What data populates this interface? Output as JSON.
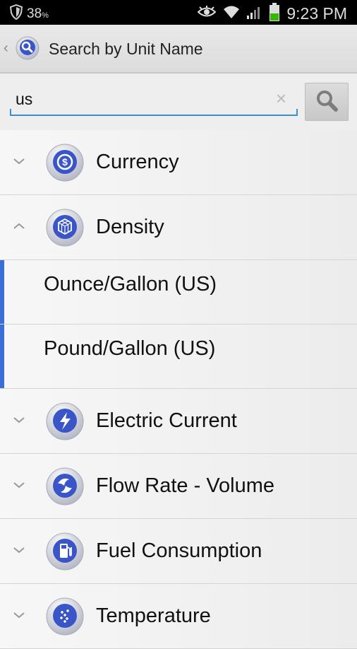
{
  "status_bar": {
    "battery_percent": "38",
    "battery_unit": "%",
    "time": "9:23 PM",
    "icons": [
      "shield-icon",
      "eye-icon",
      "wifi-icon",
      "signal-icon",
      "battery-icon"
    ]
  },
  "action_bar": {
    "title": "Search by Unit Name",
    "icon": "search-app-icon"
  },
  "search": {
    "value": "us",
    "clear_glyph": "×"
  },
  "list": {
    "currency": {
      "label": "Currency",
      "icon": "currency-icon",
      "expanded": false
    },
    "density": {
      "label": "Density",
      "icon": "density-icon",
      "expanded": true
    },
    "units": [
      "Ounce/Gallon (US)",
      "Pound/Gallon (US)"
    ],
    "electric_current": {
      "label": "Electric Current",
      "icon": "electric-current-icon",
      "expanded": false
    },
    "flow_rate": {
      "label": "Flow Rate - Volume",
      "icon": "flow-rate-icon",
      "expanded": false
    },
    "fuel": {
      "label": "Fuel Consumption",
      "icon": "fuel-icon",
      "expanded": false
    },
    "temperature": {
      "label": "Temperature",
      "icon": "temperature-icon",
      "expanded": false
    }
  },
  "colors": {
    "accent_blue": "#3b6fd6",
    "search_underline": "#3d8fd1",
    "icon_blue": "#3a55c8"
  }
}
